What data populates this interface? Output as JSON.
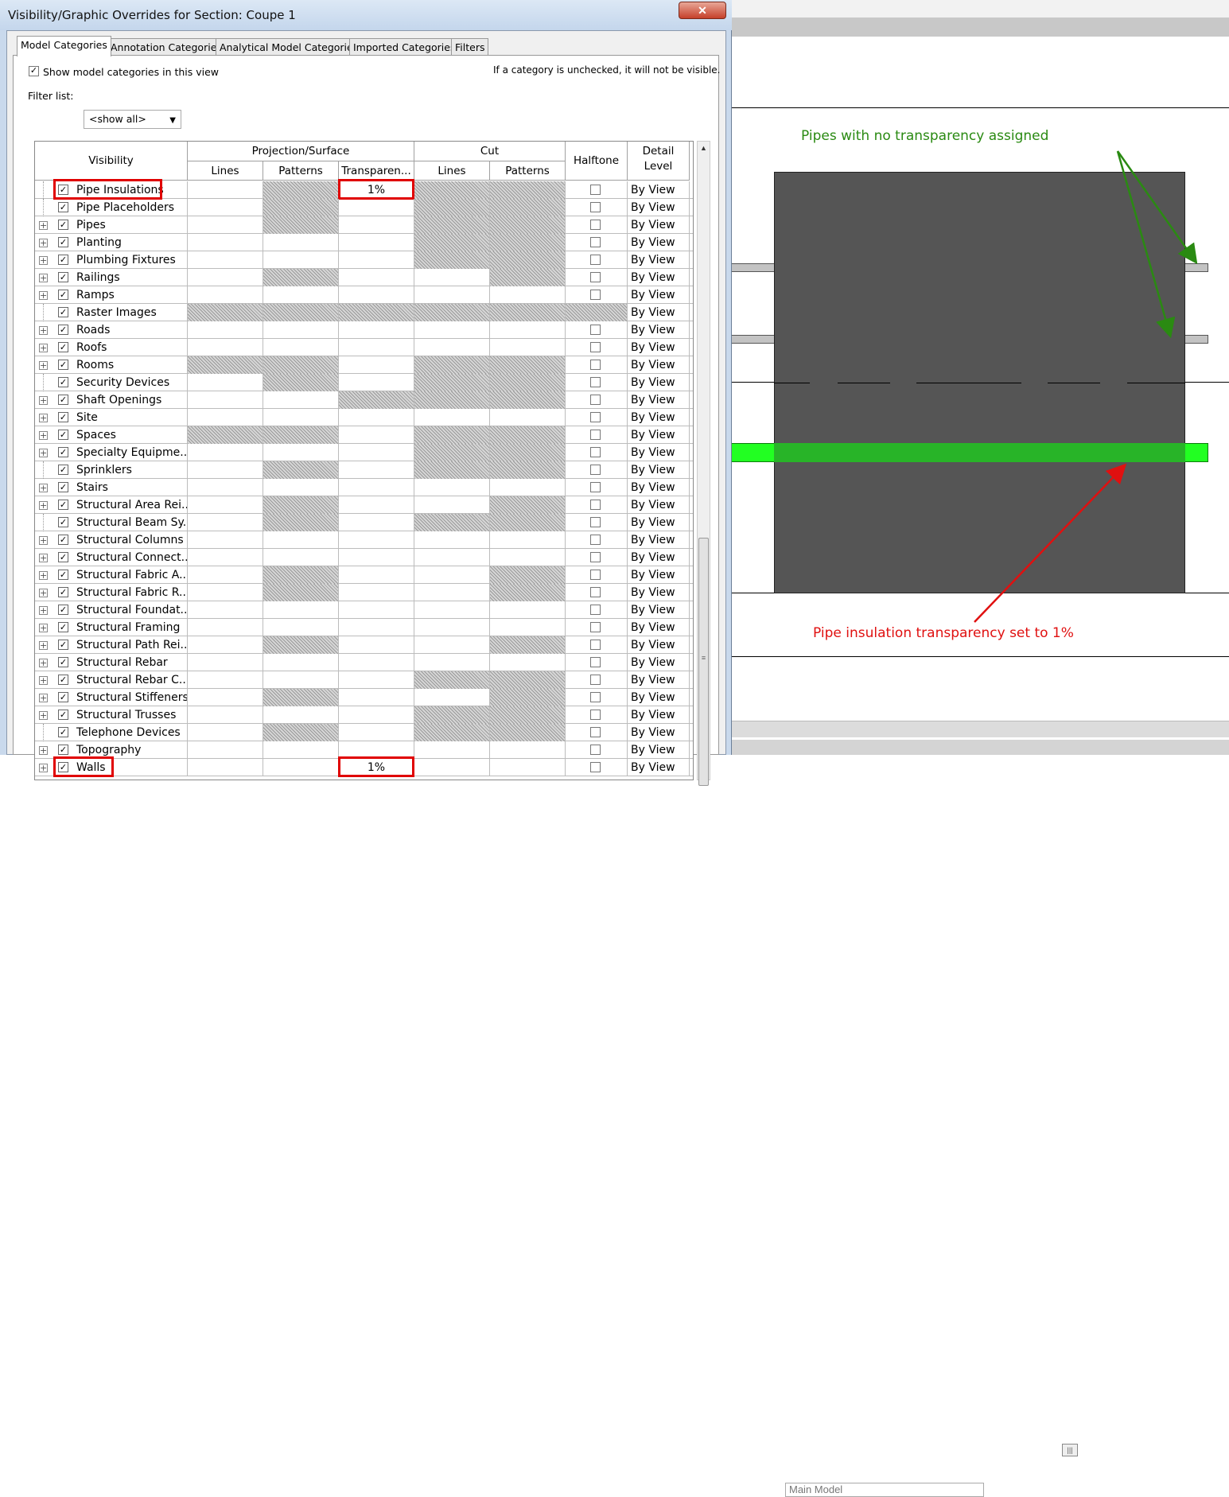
{
  "dialog": {
    "title": "Visibility/Graphic Overrides for Section: Coupe 1",
    "close_label": "✕",
    "tabs": [
      "Model Categories",
      "Annotation Categories",
      "Analytical Model Categories",
      "Imported Categories",
      "Filters"
    ],
    "show_categories_label": "Show model categories in this view",
    "show_categories_checked": true,
    "hint": "If a category is unchecked, it will not be visible.",
    "filter_label": "Filter list:",
    "filter_value": "<show all>"
  },
  "grid": {
    "headers": {
      "visibility": "Visibility",
      "projection": "Projection/Surface",
      "cut": "Cut",
      "halftone": "Halftone",
      "detail": "Detail Level",
      "lines": "Lines",
      "patterns": "Patterns",
      "transparency": "Transparen...",
      "cut_lines": "Lines",
      "cut_patterns": "Patterns"
    },
    "rows": [
      {
        "name": "Pipe Insulations",
        "expand": false,
        "hatch": [
          0,
          1,
          0,
          1,
          1,
          0
        ],
        "transparency": "1%",
        "detail": "By View",
        "highlight": true
      },
      {
        "name": "Pipe Placeholders",
        "expand": false,
        "hatch": [
          0,
          1,
          0,
          1,
          1,
          0
        ],
        "transparency": "",
        "detail": "By View"
      },
      {
        "name": "Pipes",
        "expand": true,
        "hatch": [
          0,
          1,
          0,
          1,
          1,
          0
        ],
        "transparency": "",
        "detail": "By View"
      },
      {
        "name": "Planting",
        "expand": true,
        "hatch": [
          0,
          0,
          0,
          1,
          1,
          0
        ],
        "transparency": "",
        "detail": "By View"
      },
      {
        "name": "Plumbing Fixtures",
        "expand": true,
        "hatch": [
          0,
          0,
          0,
          1,
          1,
          0
        ],
        "transparency": "",
        "detail": "By View"
      },
      {
        "name": "Railings",
        "expand": true,
        "hatch": [
          0,
          1,
          0,
          0,
          1,
          0
        ],
        "transparency": "",
        "detail": "By View"
      },
      {
        "name": "Ramps",
        "expand": true,
        "hatch": [
          0,
          0,
          0,
          0,
          0,
          0
        ],
        "transparency": "",
        "detail": "By View"
      },
      {
        "name": "Raster Images",
        "expand": false,
        "hatch": [
          1,
          1,
          1,
          1,
          1,
          1
        ],
        "transparency": "",
        "detail": "By View"
      },
      {
        "name": "Roads",
        "expand": true,
        "hatch": [
          0,
          0,
          0,
          0,
          0,
          0
        ],
        "transparency": "",
        "detail": "By View"
      },
      {
        "name": "Roofs",
        "expand": true,
        "hatch": [
          0,
          0,
          0,
          0,
          0,
          0
        ],
        "transparency": "",
        "detail": "By View"
      },
      {
        "name": "Rooms",
        "expand": true,
        "hatch": [
          1,
          1,
          0,
          1,
          1,
          0
        ],
        "transparency": "",
        "detail": "By View"
      },
      {
        "name": "Security Devices",
        "expand": false,
        "hatch": [
          0,
          1,
          0,
          1,
          1,
          0
        ],
        "transparency": "",
        "detail": "By View"
      },
      {
        "name": "Shaft Openings",
        "expand": true,
        "hatch": [
          0,
          0,
          1,
          1,
          1,
          0
        ],
        "transparency": "",
        "detail": "By View"
      },
      {
        "name": "Site",
        "expand": true,
        "hatch": [
          0,
          0,
          0,
          0,
          0,
          0
        ],
        "transparency": "",
        "detail": "By View"
      },
      {
        "name": "Spaces",
        "expand": true,
        "hatch": [
          1,
          1,
          0,
          1,
          1,
          0
        ],
        "transparency": "",
        "detail": "By View"
      },
      {
        "name": "Specialty Equipme...",
        "expand": true,
        "hatch": [
          0,
          0,
          0,
          1,
          1,
          0
        ],
        "transparency": "",
        "detail": "By View"
      },
      {
        "name": "Sprinklers",
        "expand": false,
        "hatch": [
          0,
          1,
          0,
          1,
          1,
          0
        ],
        "transparency": "",
        "detail": "By View"
      },
      {
        "name": "Stairs",
        "expand": true,
        "hatch": [
          0,
          0,
          0,
          0,
          0,
          0
        ],
        "transparency": "",
        "detail": "By View"
      },
      {
        "name": "Structural Area Rei...",
        "expand": true,
        "hatch": [
          0,
          1,
          0,
          0,
          1,
          0
        ],
        "transparency": "",
        "detail": "By View"
      },
      {
        "name": "Structural Beam Sy...",
        "expand": false,
        "hatch": [
          0,
          1,
          0,
          1,
          1,
          0
        ],
        "transparency": "",
        "detail": "By View"
      },
      {
        "name": "Structural Columns",
        "expand": true,
        "hatch": [
          0,
          0,
          0,
          0,
          0,
          0
        ],
        "transparency": "",
        "detail": "By View"
      },
      {
        "name": "Structural Connect...",
        "expand": true,
        "hatch": [
          0,
          0,
          0,
          0,
          0,
          0
        ],
        "transparency": "",
        "detail": "By View"
      },
      {
        "name": "Structural Fabric A...",
        "expand": true,
        "hatch": [
          0,
          1,
          0,
          0,
          1,
          0
        ],
        "transparency": "",
        "detail": "By View"
      },
      {
        "name": "Structural Fabric R...",
        "expand": true,
        "hatch": [
          0,
          1,
          0,
          0,
          1,
          0
        ],
        "transparency": "",
        "detail": "By View"
      },
      {
        "name": "Structural Foundat...",
        "expand": true,
        "hatch": [
          0,
          0,
          0,
          0,
          0,
          0
        ],
        "transparency": "",
        "detail": "By View"
      },
      {
        "name": "Structural Framing",
        "expand": true,
        "hatch": [
          0,
          0,
          0,
          0,
          0,
          0
        ],
        "transparency": "",
        "detail": "By View"
      },
      {
        "name": "Structural Path Rei...",
        "expand": true,
        "hatch": [
          0,
          1,
          0,
          0,
          1,
          0
        ],
        "transparency": "",
        "detail": "By View"
      },
      {
        "name": "Structural Rebar",
        "expand": true,
        "hatch": [
          0,
          0,
          0,
          0,
          0,
          0
        ],
        "transparency": "",
        "detail": "By View"
      },
      {
        "name": "Structural Rebar C...",
        "expand": true,
        "hatch": [
          0,
          0,
          0,
          1,
          1,
          0
        ],
        "transparency": "",
        "detail": "By View"
      },
      {
        "name": "Structural Stiffeners",
        "expand": true,
        "hatch": [
          0,
          1,
          0,
          0,
          1,
          0
        ],
        "transparency": "",
        "detail": "By View"
      },
      {
        "name": "Structural Trusses",
        "expand": true,
        "hatch": [
          0,
          0,
          0,
          1,
          1,
          0
        ],
        "transparency": "",
        "detail": "By View"
      },
      {
        "name": "Telephone Devices",
        "expand": false,
        "hatch": [
          0,
          1,
          0,
          1,
          1,
          0
        ],
        "transparency": "",
        "detail": "By View"
      },
      {
        "name": "Topography",
        "expand": true,
        "hatch": [
          0,
          0,
          0,
          0,
          0,
          0
        ],
        "transparency": "",
        "detail": "By View"
      },
      {
        "name": "Walls",
        "expand": true,
        "hatch": [
          0,
          0,
          0,
          0,
          0,
          0
        ],
        "transparency": "1%",
        "detail": "By View",
        "highlight": true
      }
    ]
  },
  "canvas": {
    "note_green": "Pipes with no transparency assigned",
    "note_red": "Pipe insulation transparency set to 1%",
    "model_select": "Main Model",
    "colors": {
      "green_note": "#2a8a12",
      "red_note": "#e01010",
      "insulation": "#22ff22",
      "wall": "#555555"
    }
  }
}
